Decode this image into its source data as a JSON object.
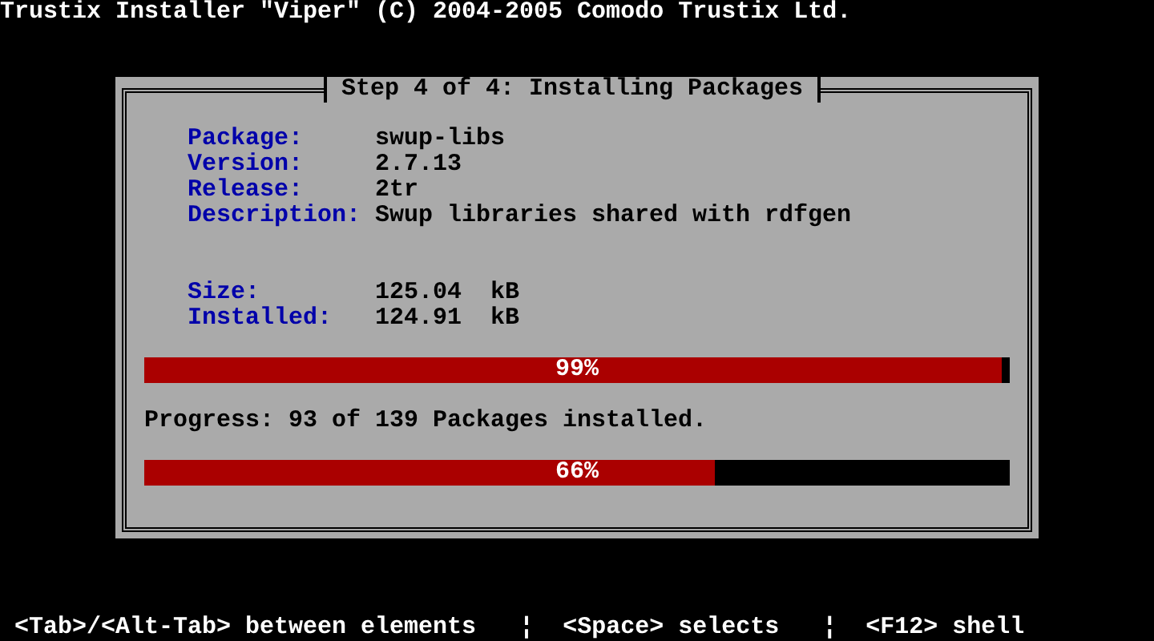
{
  "header": {
    "title": "Trustix Installer \"Viper\" (C) 2004-2005 Comodo Trustix Ltd."
  },
  "dialog": {
    "title": "Step 4 of 4: Installing Packages",
    "package_fields": [
      {
        "label": "Package:",
        "value": "swup-libs"
      },
      {
        "label": "Version:",
        "value": "2.7.13"
      },
      {
        "label": "Release:",
        "value": "2tr"
      },
      {
        "label": "Description:",
        "value": "Swup libraries shared with rdfgen"
      }
    ],
    "size_fields": [
      {
        "label": "Size:",
        "value": "125.04  kB"
      },
      {
        "label": "Installed:",
        "value": "124.91  kB"
      }
    ],
    "package_progress": {
      "level": 0.99,
      "reading": "99%"
    },
    "progress_text": "Progress: 93 of 139 Packages installed.",
    "total_progress": {
      "level": 0.66,
      "reading": "66%"
    }
  },
  "footer": {
    "hints": [
      "<Tab>/<Alt-Tab> between elements",
      "<Space> selects",
      "<F12> shell"
    ],
    "separator": "¦"
  }
}
